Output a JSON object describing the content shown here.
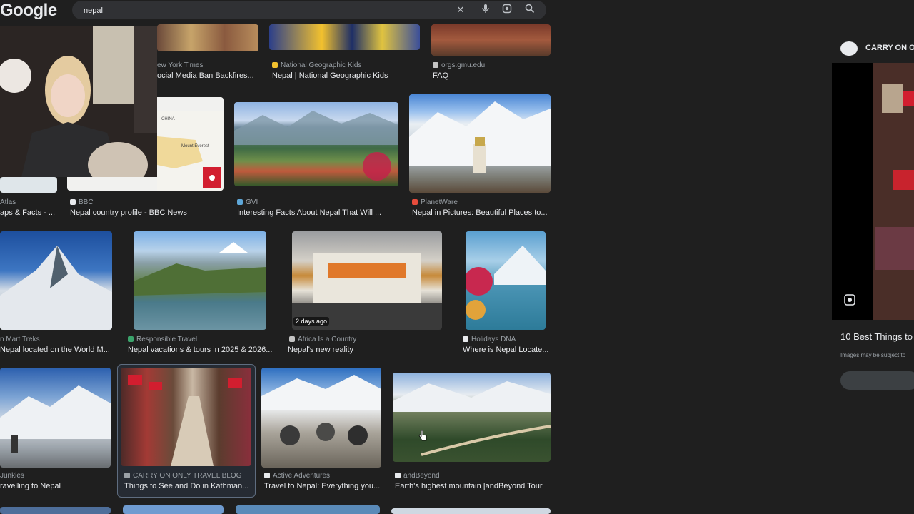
{
  "header": {
    "logo": "Google",
    "search_value": "nepal",
    "icons": [
      "close-icon",
      "mic-icon",
      "lens-icon",
      "search-icon"
    ]
  },
  "results": [
    {
      "source": "ew York Times",
      "title": "ocial Media Ban Backfires..."
    },
    {
      "source": "National Geographic Kids",
      "title": "Nepal | National Geographic Kids"
    },
    {
      "source": "orgs.gmu.edu",
      "title": "FAQ"
    },
    {
      "source": "Atlas",
      "title": "aps & Facts - ..."
    },
    {
      "source": "BBC",
      "title": "Nepal country profile - BBC News"
    },
    {
      "source": "GVI",
      "title": "Interesting Facts About Nepal That Will ..."
    },
    {
      "source": "PlanetWare",
      "title": "Nepal in Pictures: Beautiful Places to..."
    },
    {
      "source": "n Mart Treks",
      "title": "Nepal located on the World M..."
    },
    {
      "source": "Responsible Travel",
      "title": "Nepal vacations & tours in 2025 & 2026..."
    },
    {
      "source": "Africa Is a Country",
      "title": "Nepal's new reality",
      "badge": "2 days ago"
    },
    {
      "source": "Holidays DNA",
      "title": "Where is Nepal Locate..."
    },
    {
      "source": "Junkies",
      "title": "ravelling to Nepal"
    },
    {
      "source": "CARRY ON ONLY TRAVEL BLOG",
      "title": "Things to See and Do in Kathman..."
    },
    {
      "source": "Active Adventures",
      "title": "Travel to Nepal: Everything you..."
    },
    {
      "source": "andBeyond",
      "title": "Earth's highest mountain |andBeyond Tour"
    }
  ],
  "map_labels": {
    "country": "CHINA",
    "peak": "Mount Everest"
  },
  "panel": {
    "source": "CARRY ON ON",
    "title": "10 Best Things to",
    "note": "Images may be subject to"
  },
  "colors": {
    "background": "#1f1f1f",
    "search_bar": "#303134",
    "text": "#e8eaed",
    "muted": "#9aa0a6"
  }
}
